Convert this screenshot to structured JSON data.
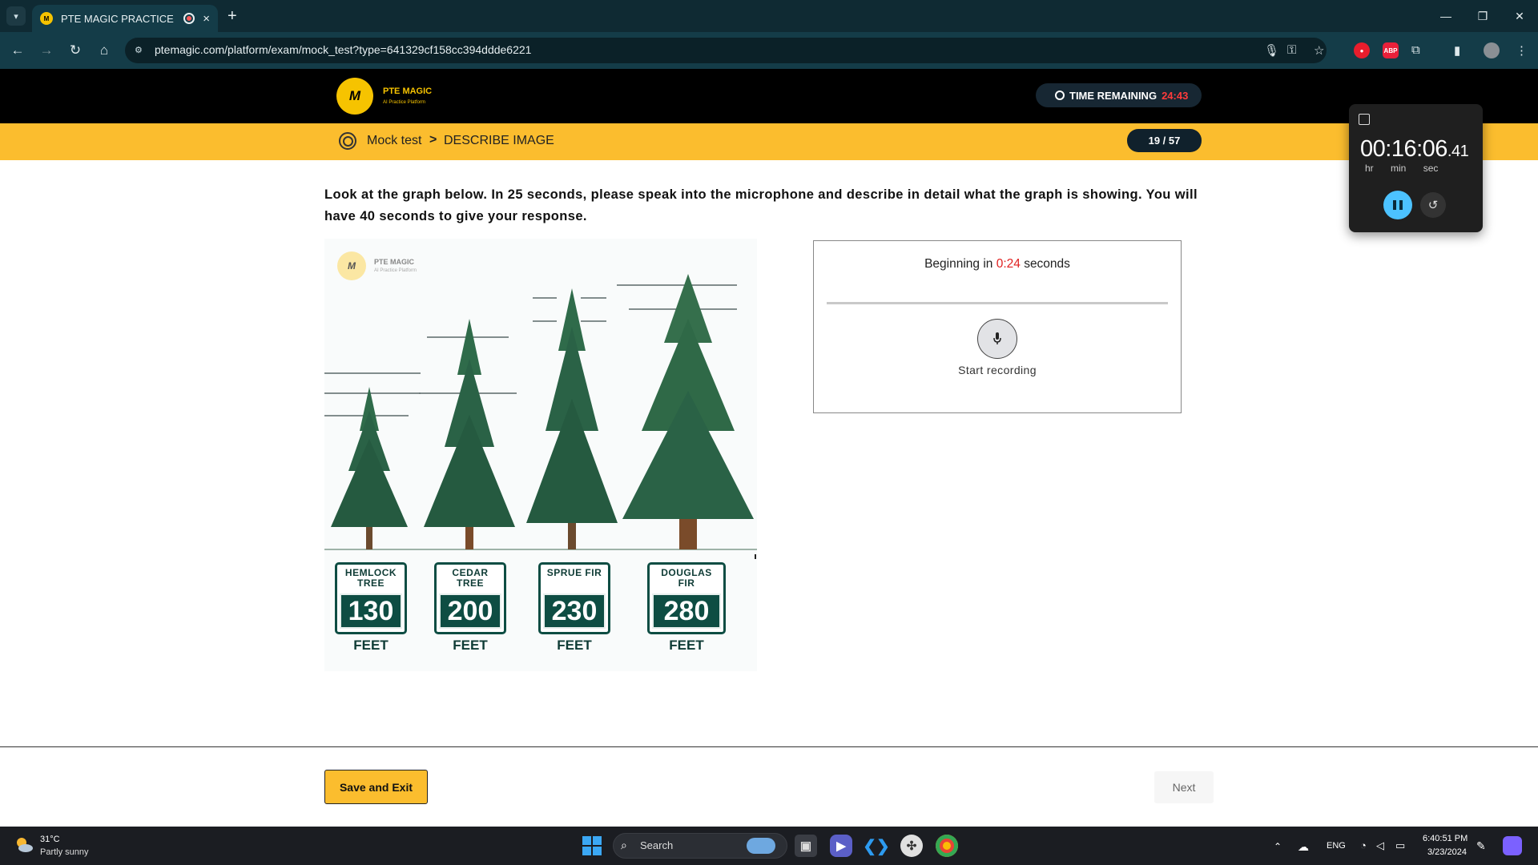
{
  "browser": {
    "tab_title": "PTE MAGIC PRACTICE",
    "url": "ptemagic.com/platform/exam/mock_test?type=641329cf158cc394ddde6221",
    "extensions": [
      "mic-icon",
      "password-key-icon",
      "bookmark-star-icon",
      "shield-extension-icon",
      "adblock-extension-icon",
      "puzzle-extensions-icon",
      "side-panel-icon",
      "profile-avatar"
    ],
    "adblock_label": "ABP"
  },
  "header": {
    "brand_name": "PTE MAGIC",
    "brand_tagline": "AI Practice Platform",
    "time_remaining_label": "TIME REMAINING",
    "time_remaining_value": "24:43"
  },
  "breadcrumb": {
    "section": "Mock test",
    "separator": ">",
    "page": "DESCRIBE IMAGE",
    "progress": "19 / 57"
  },
  "question": {
    "instructions": "Look at the graph below. In 25 seconds, please speak into the microphone and describe in detail what the graph is showing. You will have 40 seconds to give your response."
  },
  "image": {
    "watermark_name": "PTE MAGIC",
    "watermark_tagline": "AI Practice Platform",
    "trees": [
      {
        "name": "HEMLOCK TREE",
        "height": "130",
        "unit": "FEET"
      },
      {
        "name": "CEDAR TREE",
        "height": "200",
        "unit": "FEET"
      },
      {
        "name": "SPRUE FIR",
        "height": "230",
        "unit": "FEET"
      },
      {
        "name": "DOUGLAS FIR",
        "height": "280",
        "unit": "FEET"
      }
    ]
  },
  "recorder": {
    "status_prefix": "Beginning in",
    "countdown": "0:24",
    "status_suffix": "seconds",
    "start_label": "Start recording"
  },
  "stopwatch": {
    "time": "00:16:06",
    "ms": ".41",
    "units": [
      "hr",
      "min",
      "sec"
    ]
  },
  "footer": {
    "save_exit": "Save and Exit",
    "next": "Next"
  },
  "taskbar": {
    "temperature": "31°C",
    "weather": "Partly sunny",
    "search_placeholder": "Search",
    "language": "ENG",
    "time": "6:40:51 PM",
    "date": "3/23/2024"
  },
  "colors": {
    "accent_yellow": "#fbbd2e",
    "brand_yellow": "#f6c300",
    "countdown_red": "#e02020",
    "sign_green": "#0e4d43"
  }
}
